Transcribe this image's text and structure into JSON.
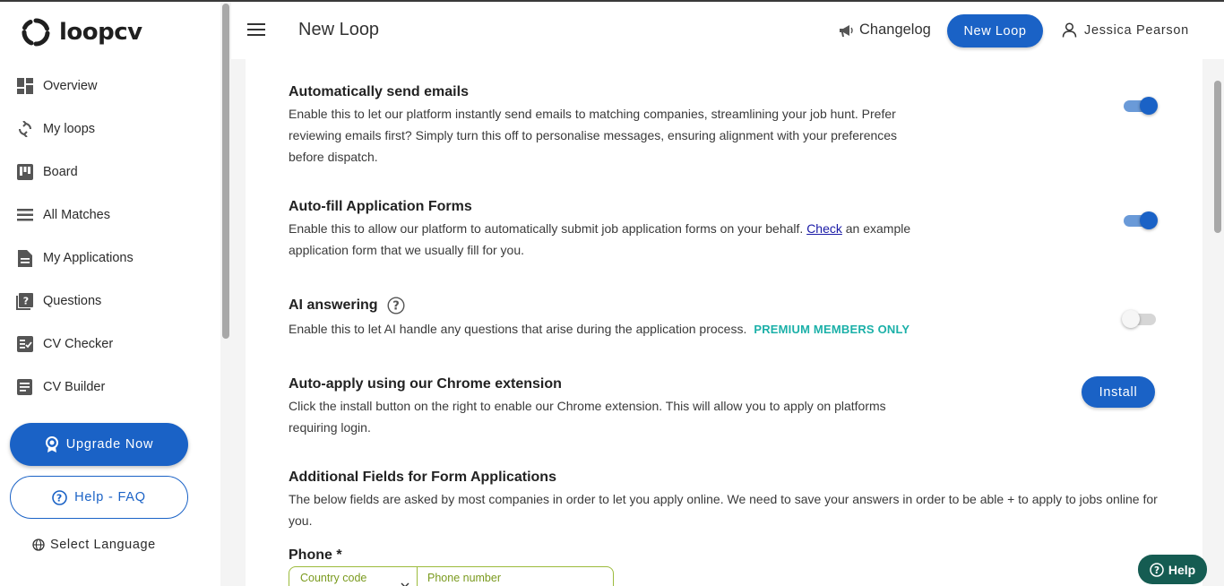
{
  "brand": {
    "name": "loopcv"
  },
  "sidebar": {
    "items": [
      {
        "label": "Overview",
        "icon": "dashboard-icon"
      },
      {
        "label": "My loops",
        "icon": "loop-icon"
      },
      {
        "label": "Board",
        "icon": "board-icon"
      },
      {
        "label": "All Matches",
        "icon": "list-icon"
      },
      {
        "label": "My Applications",
        "icon": "document-icon"
      },
      {
        "label": "Questions",
        "icon": "question-icon"
      },
      {
        "label": "CV Checker",
        "icon": "checker-icon"
      },
      {
        "label": "CV Builder",
        "icon": "builder-icon"
      }
    ],
    "upgrade_label": "Upgrade Now",
    "help_label": "Help - FAQ",
    "language_label": "Select Language"
  },
  "header": {
    "title": "New Loop",
    "changelog_label": "Changelog",
    "new_loop_label": "New Loop",
    "user_name": "Jessica Pearson"
  },
  "settings": {
    "auto_email": {
      "title": "Automatically send emails",
      "description": "Enable this to let our platform instantly send emails to matching companies, streamlining your job hunt. Prefer reviewing emails first? Simply turn this off to personalise messages, ensuring alignment with your preferences before dispatch.",
      "enabled": true
    },
    "auto_fill": {
      "title": "Auto-fill Application Forms",
      "description_before": "Enable this to allow our platform to automatically submit job application forms on your behalf. ",
      "link_label": "Check",
      "description_after": " an example application form that we usually fill for you.",
      "enabled": true
    },
    "ai_answering": {
      "title": "AI answering",
      "description": "Enable this to let AI handle any questions that arise during the application process.",
      "badge": "PREMIUM MEMBERS ONLY",
      "enabled": false
    },
    "chrome_ext": {
      "title": "Auto-apply using our Chrome extension",
      "description": "Click the install button on the right to enable our Chrome extension. This will allow you to apply on platforms requiring login.",
      "install_label": "Install"
    },
    "additional": {
      "title": "Additional Fields for Form Applications",
      "description": "The below fields are asked by most companies in order to let you apply online. We need to save your answers in order to be able + to apply to jobs online for you."
    },
    "phone": {
      "label": "Phone *",
      "country_placeholder": "Country code",
      "number_placeholder": "Phone number"
    }
  },
  "help_chip": {
    "label": "Help"
  },
  "colors": {
    "primary": "#1a62c6",
    "premium": "#1bb0a8",
    "help_chip": "#155c52",
    "field_border": "#9cbb3c"
  }
}
